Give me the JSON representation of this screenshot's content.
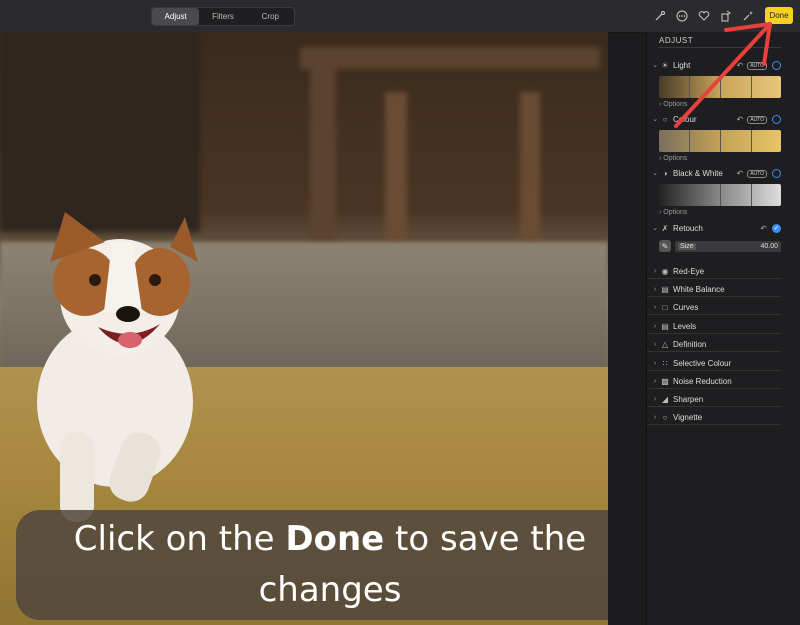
{
  "toolbar": {
    "tabs": [
      "Adjust",
      "Filters",
      "Crop"
    ],
    "active_tab": "Adjust",
    "icons": [
      "magic-wand-icon",
      "more-icon",
      "heart-icon",
      "rotate-icon",
      "auto-enhance-icon"
    ],
    "done_label": "Done",
    "done_color": "#f4d21f"
  },
  "panel": {
    "title": "ADJUST",
    "light": {
      "label": "Light",
      "auto": "AUTO",
      "options": "Options"
    },
    "colour": {
      "label": "Colour",
      "auto": "AUTO",
      "options": "Options"
    },
    "bw": {
      "label": "Black & White",
      "auto": "AUTO",
      "options": "Options"
    },
    "retouch": {
      "label": "Retouch",
      "size_label": "Size",
      "size_value": "40.00"
    },
    "items": [
      "Red-Eye",
      "White Balance",
      "Curves",
      "Levels",
      "Definition",
      "Selective Colour",
      "Noise Reduction",
      "Sharpen",
      "Vignette"
    ]
  },
  "caption": {
    "part1": "Click on the ",
    "bold": "Done",
    "part2": " to save the changes"
  },
  "accent_color": "#3a8ef5",
  "arrow_color": "#e8403a"
}
